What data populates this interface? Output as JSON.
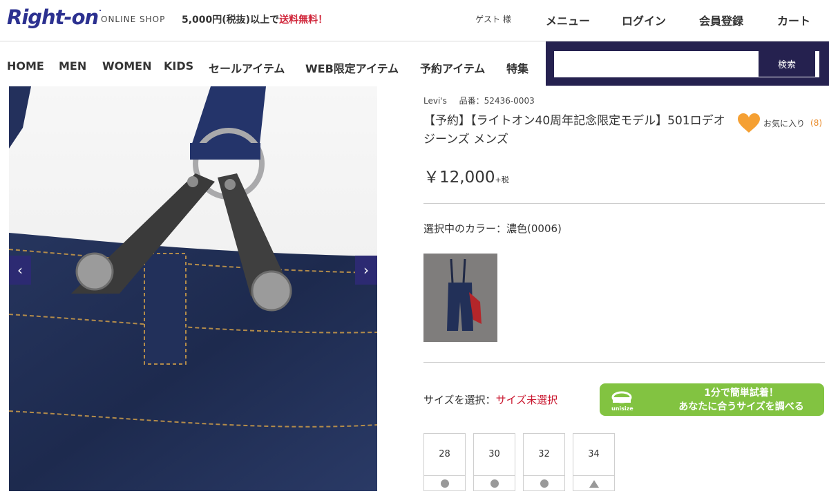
{
  "header": {
    "logo": "Right-on",
    "logo_mark": ".",
    "shop_label": "ONLINE SHOP",
    "shipping_prefix": "5,000円(税抜)以上で",
    "shipping_free": "送料無料！",
    "guest": "ゲスト 様",
    "menu": "メニュー",
    "login": "ログイン",
    "register": "会員登録",
    "cart": "カート"
  },
  "nav": {
    "items": [
      "HOME",
      "MEN",
      "WOMEN",
      "KIDS",
      "セールアイテム",
      "WEB限定アイテム",
      "予約アイテム",
      "特集"
    ]
  },
  "search": {
    "placeholder": "",
    "button": "検索"
  },
  "gallery": {
    "prev_icon": "chevron-left-icon",
    "next_icon": "chevron-right-icon"
  },
  "product": {
    "brand": "Levi's",
    "code": "品番：52436-0003",
    "title": "【予約】【ライトオン40周年記念限定モデル】501ロデオジーンズ メンズ",
    "favorite_label": "お気に入り",
    "favorite_count": "(8)",
    "price": "￥12,000",
    "tax": "+税",
    "color_label": "選択中のカラー：濃色(0006)",
    "size_label": "サイズを選択：",
    "size_status": "サイズ未選択",
    "fit_line1": "1分で簡単試着！",
    "fit_line2": "あなたに合うサイズを調べる",
    "fit_logo": "unisize",
    "sizes": [
      {
        "label": "28",
        "stock": "available"
      },
      {
        "label": "30",
        "stock": "available"
      },
      {
        "label": "32",
        "stock": "available"
      },
      {
        "label": "34",
        "stock": "few"
      }
    ]
  },
  "colors": {
    "brand": "#2c3190",
    "nav_search_bg": "#25214f",
    "alert": "#c9142c",
    "fit_button": "#82c341",
    "favorite": "#f5a033"
  }
}
